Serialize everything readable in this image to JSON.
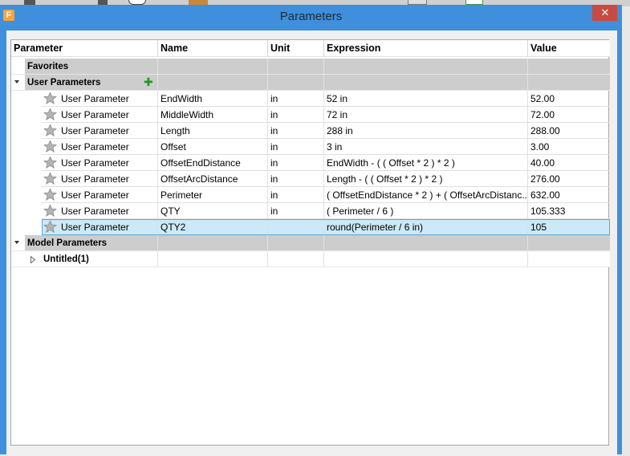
{
  "window": {
    "title": "Parameters",
    "app_icon": "F",
    "close_glyph": "✕"
  },
  "columns": {
    "parameter": "Parameter",
    "name": "Name",
    "unit": "Unit",
    "expression": "Expression",
    "value": "Value"
  },
  "groups": {
    "favorites": "Favorites",
    "user_parameters": "User Parameters",
    "model_parameters": "Model Parameters",
    "untitled": "Untitled(1)"
  },
  "rows": [
    {
      "type": "User Parameter",
      "name": "EndWidth",
      "unit": "in",
      "expression": "52 in",
      "value": "52.00"
    },
    {
      "type": "User Parameter",
      "name": "MiddleWidth",
      "unit": "in",
      "expression": "72 in",
      "value": "72.00"
    },
    {
      "type": "User Parameter",
      "name": "Length",
      "unit": "in",
      "expression": "288 in",
      "value": "288.00"
    },
    {
      "type": "User Parameter",
      "name": "Offset",
      "unit": "in",
      "expression": "3 in",
      "value": "3.00"
    },
    {
      "type": "User Parameter",
      "name": "OffsetEndDistance",
      "unit": "in",
      "expression": "EndWidth - ( ( Offset * 2 ) * 2 )",
      "value": "40.00"
    },
    {
      "type": "User Parameter",
      "name": "OffsetArcDistance",
      "unit": "in",
      "expression": "Length - ( ( Offset * 2 ) * 2 )",
      "value": "276.00"
    },
    {
      "type": "User Parameter",
      "name": "Perimeter",
      "unit": "in",
      "expression": "( OffsetEndDistance * 2 ) + ( OffsetArcDistanc...",
      "value": "632.00"
    },
    {
      "type": "User Parameter",
      "name": "QTY",
      "unit": "in",
      "expression": "( Perimeter / 6 )",
      "value": "105.333"
    },
    {
      "type": "User Parameter",
      "name": "QTY2",
      "unit": "",
      "expression": "round(Perimeter / 6 in)",
      "value": "105"
    }
  ],
  "selected_row_index": 8,
  "icons": {
    "star": "star-icon",
    "add": "add-parameter-icon",
    "expand": "expand-arrow-icon",
    "collapse": "collapse-arrow-icon"
  },
  "colors": {
    "titlebar": "#3f8fdc",
    "close": "#c74b41",
    "group_header_bg": "#cdcdcd",
    "selected_bg": "#cde8f6",
    "selected_border": "#5fa6d6",
    "add_green": "#1e9a1e"
  }
}
